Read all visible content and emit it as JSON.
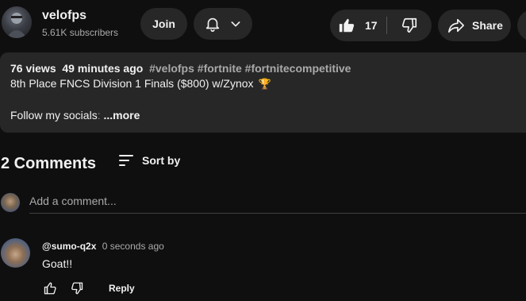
{
  "channel": {
    "name": "velofps",
    "subscribers": "5.61K subscribers",
    "join_label": "Join"
  },
  "actions": {
    "like_count": "17",
    "share_label": "Share",
    "icons": {
      "bell": "bell-icon",
      "chevron": "chevron-down-icon",
      "like": "thumbs-up-icon",
      "dislike": "thumbs-down-icon",
      "share": "share-arrow-icon"
    }
  },
  "description": {
    "views": "76 views",
    "time": "49 minutes ago",
    "hashtags": "#velofps #fortnite #fortnitecompetitive",
    "title": "8th Place FNCS Division 1 Finals ($800) w/Zynox",
    "follow_text": "Follow my socials",
    "follow_fade": ":",
    "more_label": "...more"
  },
  "comments": {
    "count_label": "2 Comments",
    "sort_label": "Sort by",
    "add_placeholder": "Add a comment...",
    "items": [
      {
        "author": "@sumo-q2x",
        "time": "0 seconds ago",
        "text": "Goat!!",
        "reply_label": "Reply"
      }
    ]
  },
  "colors": {
    "background": "#0f0f0f",
    "surface": "#272727",
    "text": "#f1f1f1",
    "muted": "#aaaaaa"
  }
}
